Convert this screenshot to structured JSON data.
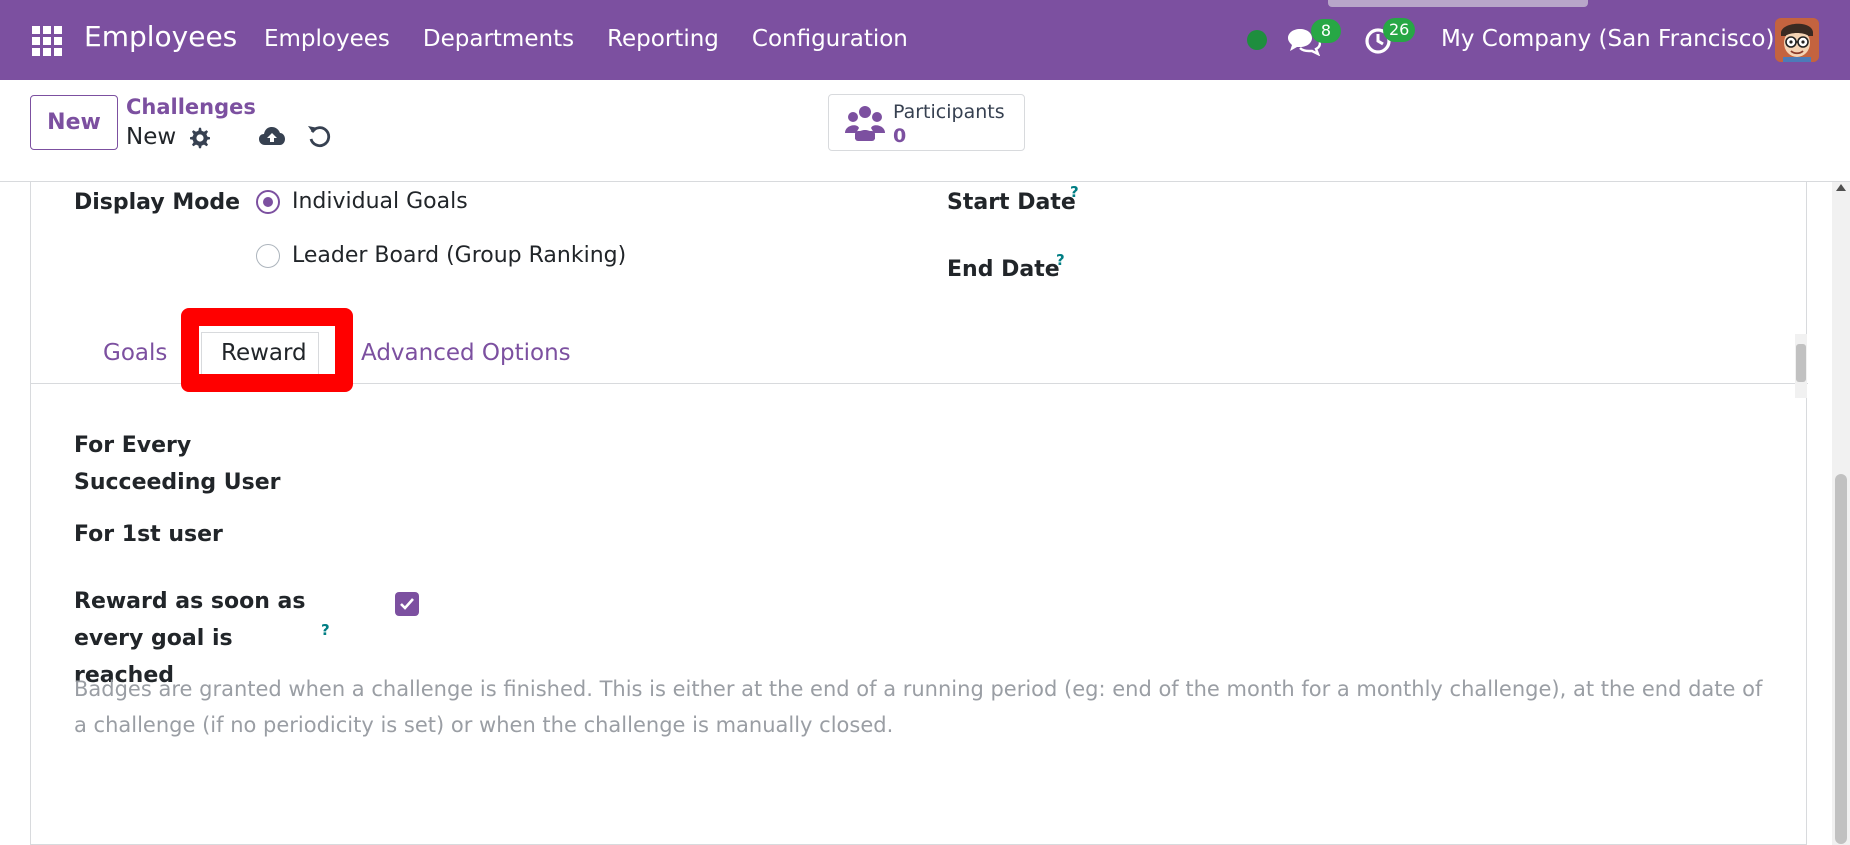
{
  "navbar": {
    "brand": "Employees",
    "menu": [
      "Employees",
      "Departments",
      "Reporting",
      "Configuration"
    ],
    "messages_count": "8",
    "activities_count": "26",
    "company": "My Company (San Francisco)",
    "accent_color": "#7c50a0"
  },
  "control_panel": {
    "new_label": "New",
    "breadcrumb": "Challenges",
    "record_name": "New",
    "participants_label": "Participants",
    "participants_count": "0"
  },
  "form": {
    "display_mode_label": "Display Mode",
    "display_mode_options": [
      "Individual Goals",
      "Leader Board (Group Ranking)"
    ],
    "display_mode_selected": "Individual Goals",
    "start_date_label": "Start Date",
    "end_date_label": "End Date",
    "help_mark": "?",
    "tabs": [
      "Goals",
      "Reward",
      "Advanced Options"
    ],
    "active_tab": "Reward",
    "reward": {
      "every_succeeding_label": "For Every Succeeding User",
      "first_user_label": "For 1st user",
      "reward_realtime_label": "Reward as soon as every goal is reached",
      "reward_realtime_checked": true,
      "helper_text": "Badges are granted when a challenge is finished. This is either at the end of a running period (eg: end of the month for a monthly challenge), at the end date of a challenge (if no periodicity is set) or when the challenge is manually closed."
    }
  }
}
